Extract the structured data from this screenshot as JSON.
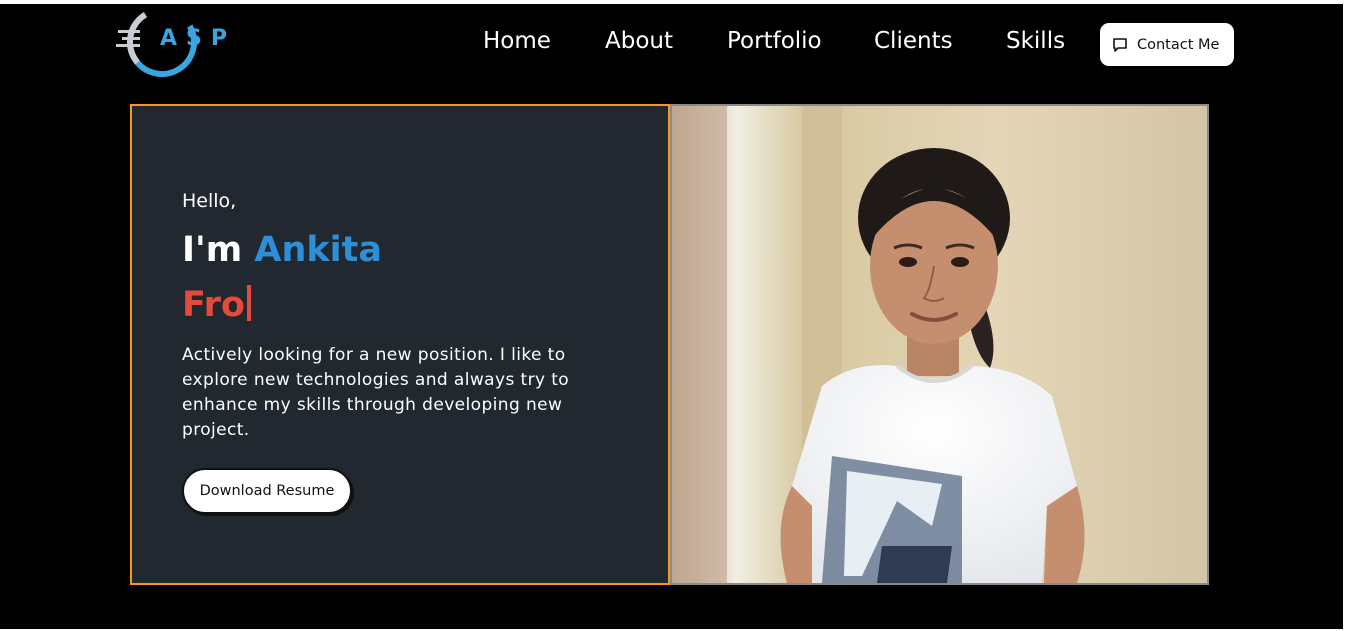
{
  "logo": {
    "text": "ASP",
    "icon": "asp-logo-icon",
    "accent": "#3aa6e0"
  },
  "nav": {
    "items": [
      {
        "label": "Home"
      },
      {
        "label": "About"
      },
      {
        "label": "Portfolio"
      },
      {
        "label": "Clients"
      },
      {
        "label": "Skills"
      }
    ],
    "contact_label": "Contact Me",
    "contact_icon": "chat-bubble-icon"
  },
  "hero": {
    "greeting": "Hello,",
    "intro": "I'm",
    "name": "Ankita",
    "typed_text": "Fro",
    "bio": "Actively looking for a new position. I like to explore new technologies and always try to enhance my skills through developing new project.",
    "download_label": "Download Resume",
    "photo": "profile-photo",
    "colors": {
      "panel_bg": "#212830",
      "panel_border": "#f39a1e",
      "name": "#2f8fd6",
      "typed": "#e64a3b"
    }
  }
}
